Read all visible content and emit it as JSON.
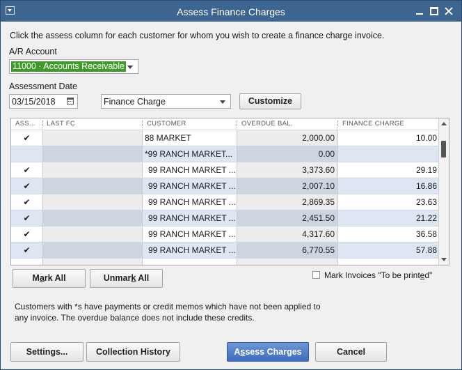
{
  "window": {
    "title": "Assess Finance Charges"
  },
  "instruction": "Click the assess column for each customer for whom you wish to create a finance charge invoice.",
  "ar_account": {
    "label": "A/R Account",
    "value": "11000 · Accounts Receivable"
  },
  "assessment_date": {
    "label": "Assessment Date",
    "value": "03/15/2018"
  },
  "template": {
    "value": "Finance Charge"
  },
  "customize_button": "Customize",
  "table": {
    "headers": [
      "ASS...",
      "LAST FC",
      "CUSTOMER",
      "OVERDUE BAL.",
      "FINANCE CHARGE"
    ],
    "rows": [
      {
        "assess": "✔",
        "last_fc": "",
        "customer": "88 MARKET",
        "overdue": "2,000.00",
        "finance": "10.00"
      },
      {
        "assess": "",
        "last_fc": "",
        "customer": "*99 RANCH MARKET...",
        "overdue": "0.00",
        "finance": ""
      },
      {
        "assess": "✔",
        "last_fc": "",
        "customer": "99 RANCH MARKET ...",
        "overdue": "3,373.60",
        "finance": "29.19"
      },
      {
        "assess": "✔",
        "last_fc": "",
        "customer": "99 RANCH MARKET ...",
        "overdue": "2,007.10",
        "finance": "16.86"
      },
      {
        "assess": "✔",
        "last_fc": "",
        "customer": "99 RANCH MARKET ...",
        "overdue": "2,869.35",
        "finance": "23.63"
      },
      {
        "assess": "✔",
        "last_fc": "",
        "customer": "99 RANCH MARKET ...",
        "overdue": "2,451.50",
        "finance": "21.22"
      },
      {
        "assess": "✔",
        "last_fc": "",
        "customer": "99 RANCH MARKET ...",
        "overdue": "4,317.60",
        "finance": "36.58"
      },
      {
        "assess": "✔",
        "last_fc": "",
        "customer": "99 RANCH MARKET ...",
        "overdue": "6,770.55",
        "finance": "57.88"
      },
      {
        "assess": "",
        "last_fc": "",
        "customer": "",
        "overdue": "",
        "finance": ""
      }
    ]
  },
  "buttons": {
    "mark_all_pre": "M",
    "mark_all_u": "a",
    "mark_all_post": "rk All",
    "unmark_all_pre": "Unmar",
    "unmark_all_u": "k",
    "unmark_all_post": " All",
    "settings": "Settings...",
    "collection_history": "Collection History",
    "assess_pre": "A",
    "assess_u": "s",
    "assess_post": "sess Charges",
    "cancel": "Cancel"
  },
  "mark_invoices": {
    "pre": "Mark Invoices \"To be print",
    "u": "e",
    "post": "d\"",
    "checked": false
  },
  "note": "Customers with *s have payments or credit memos which have not been applied to any invoice.  The overdue balance does not include these credits."
}
